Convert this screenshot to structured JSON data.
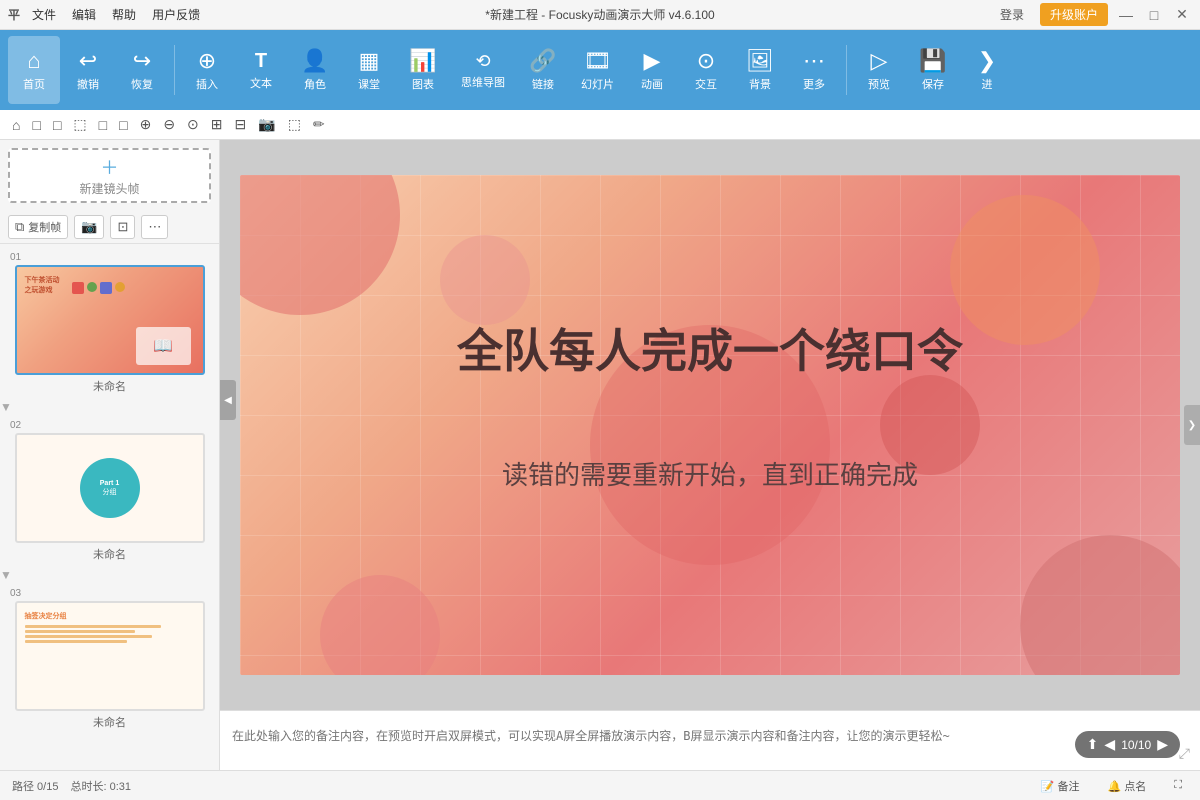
{
  "titlebar": {
    "logo": "平",
    "menus": [
      "文件",
      "编辑",
      "帮助",
      "用户反馈"
    ],
    "title": "*新建工程 - Focusky动画演示大师 v4.6.100",
    "login": "登录",
    "upgrade": "升级账户",
    "win_min": "—",
    "win_max": "□",
    "win_close": "✕"
  },
  "toolbar": {
    "items": [
      {
        "id": "home",
        "icon": "⌂",
        "label": "首页"
      },
      {
        "id": "undo",
        "icon": "↩",
        "label": "撤销"
      },
      {
        "id": "redo",
        "icon": "↪",
        "label": "恢复"
      },
      {
        "id": "insert",
        "icon": "⊕",
        "label": "插入"
      },
      {
        "id": "text",
        "icon": "T",
        "label": "文本"
      },
      {
        "id": "role",
        "icon": "☺",
        "label": "角色"
      },
      {
        "id": "class",
        "icon": "▦",
        "label": "课堂"
      },
      {
        "id": "chart",
        "icon": "📊",
        "label": "图表"
      },
      {
        "id": "mindmap",
        "icon": "⟲",
        "label": "思维导图"
      },
      {
        "id": "link",
        "icon": "⛓",
        "label": "链接"
      },
      {
        "id": "slides",
        "icon": "⬛",
        "label": "幻灯片"
      },
      {
        "id": "anim",
        "icon": "▶",
        "label": "动画"
      },
      {
        "id": "interact",
        "icon": "⊙",
        "label": "交互"
      },
      {
        "id": "bg",
        "icon": "🖼",
        "label": "背景"
      },
      {
        "id": "more",
        "icon": "…",
        "label": "更多"
      },
      {
        "id": "preview",
        "icon": "▷",
        "label": "预览"
      },
      {
        "id": "save",
        "icon": "💾",
        "label": "保存"
      },
      {
        "id": "nav",
        "icon": "❯",
        "label": "进"
      }
    ]
  },
  "secondary_toolbar": {
    "buttons": [
      "⌂",
      "□",
      "□",
      "□",
      "□",
      "□",
      "⊕",
      "⊖",
      "⊙",
      "⊞",
      "⊟",
      "📷",
      "⬚",
      "✏"
    ]
  },
  "sidebar": {
    "new_frame_label": "新建镜头帧",
    "copy_frame": "复制帧",
    "slides": [
      {
        "number": "01",
        "label": "未命名"
      },
      {
        "number": "02",
        "label": "未命名"
      },
      {
        "number": "03",
        "label": "未命名"
      }
    ]
  },
  "canvas": {
    "title": "全队每人完成一个绕口令",
    "subtitle": "读错的需要重新开始，直到正确完成",
    "nav": "10/10"
  },
  "notes": {
    "placeholder": "在此处输入您的备注内容，在预览时开启双屏模式，可以实现A屏全屏播放演示内容，B屏显示演示内容和备注内容，让您的演示更轻松~"
  },
  "statusbar": {
    "path": "路径 0/15",
    "total": "总时长: 0:31",
    "notes_btn": "备注",
    "callsign_btn": "点名"
  }
}
